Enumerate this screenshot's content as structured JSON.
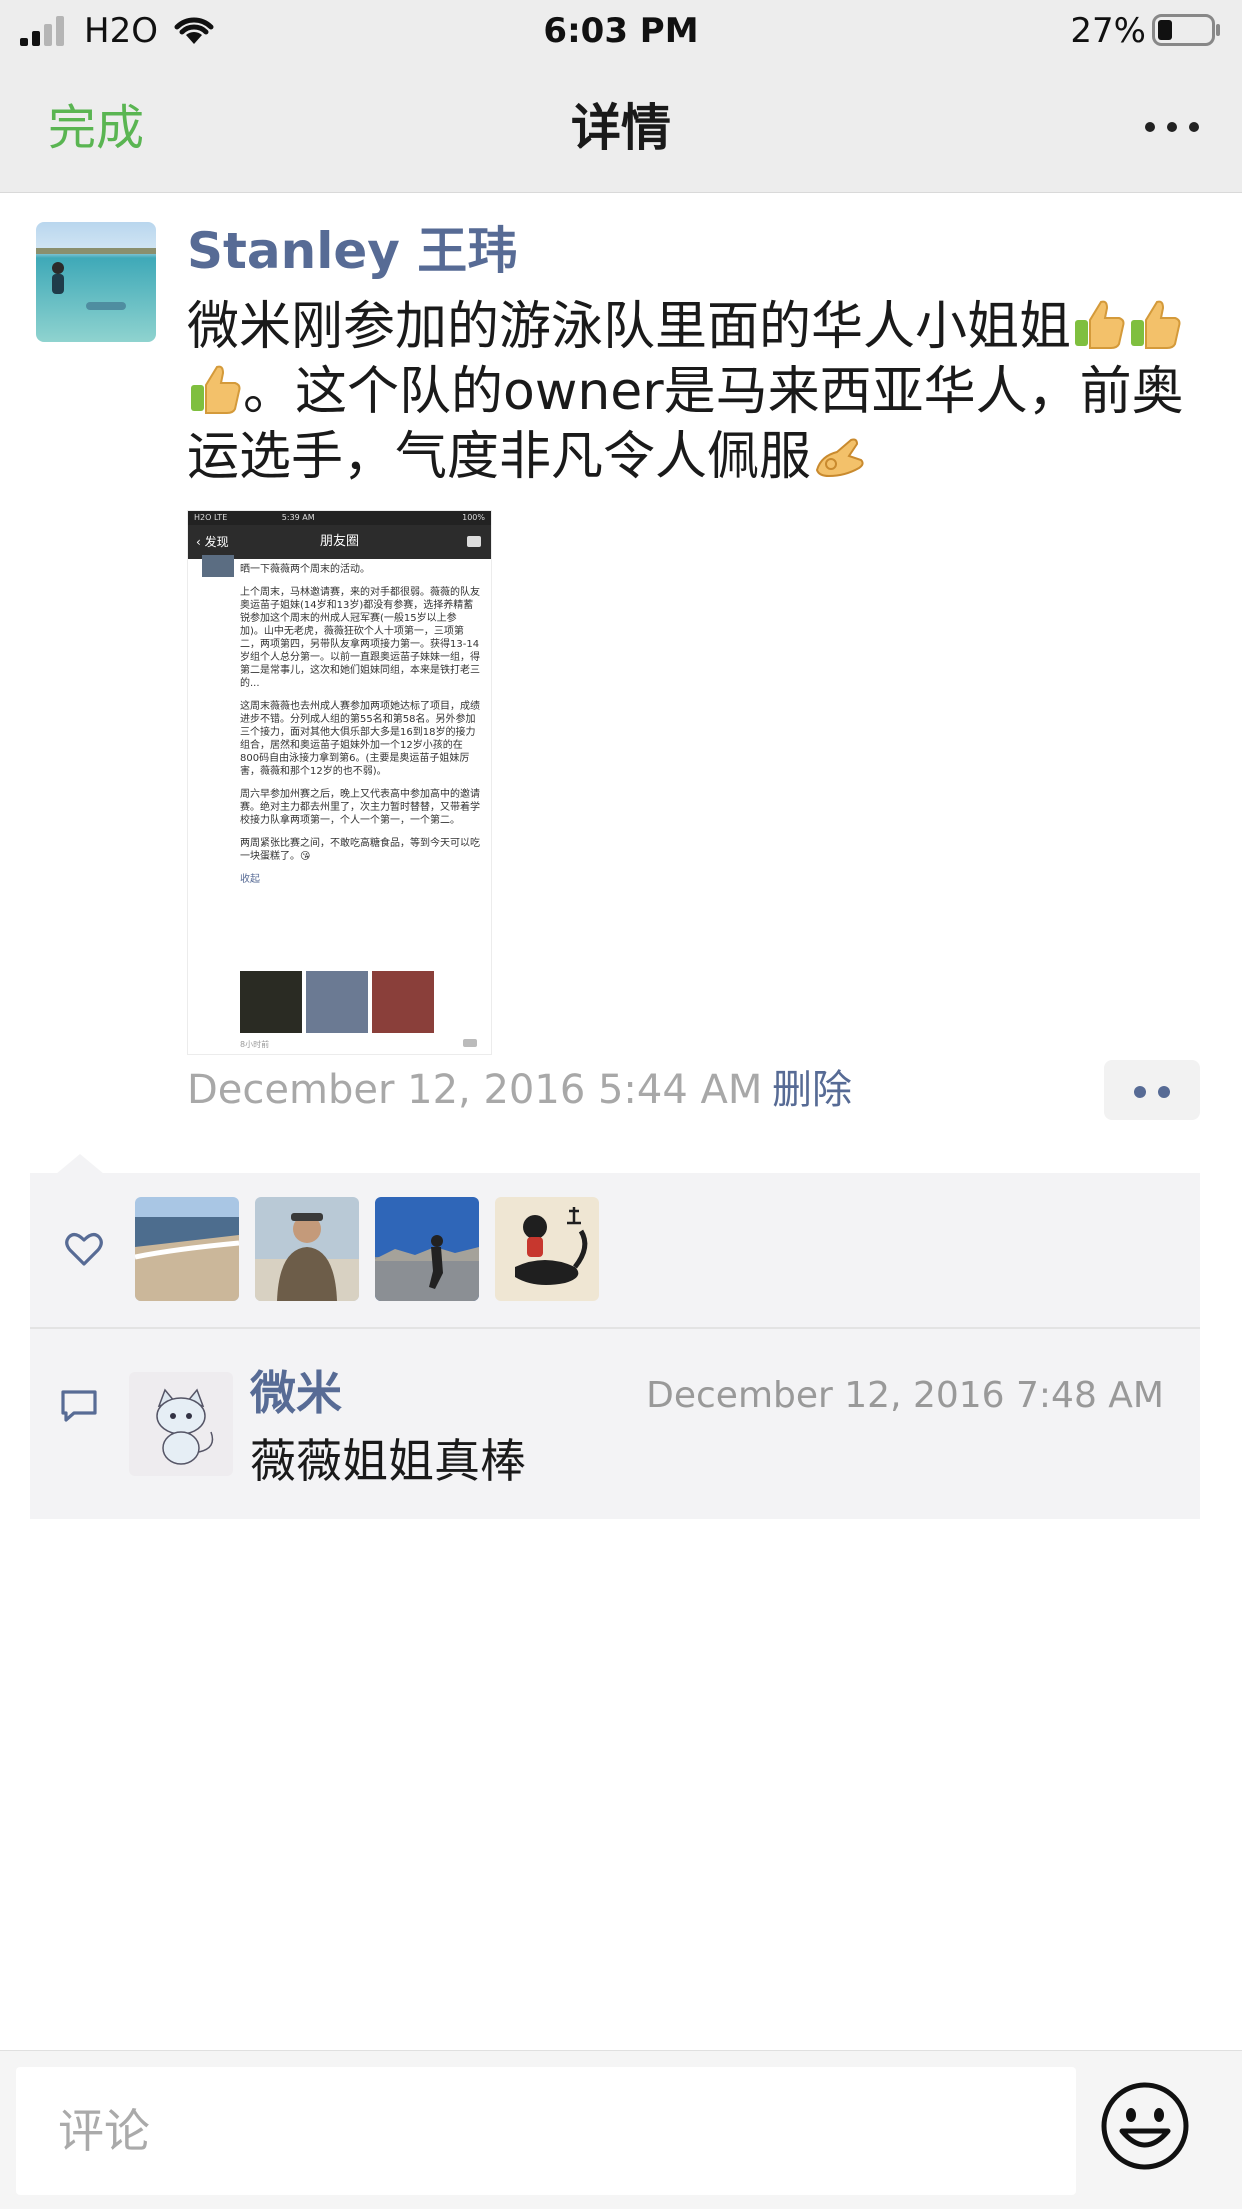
{
  "status_bar": {
    "carrier": "H2O",
    "time": "6:03 PM",
    "battery_percent": "27%",
    "battery_level": 0.27,
    "signal_bars": 2
  },
  "nav": {
    "done_label": "完成",
    "title": "详情",
    "more_icon": "more-icon"
  },
  "post": {
    "author": "Stanley 王玮",
    "text_parts": [
      "微米刚参加的游泳队里面的华人小姐姐",
      "。这个队的owner是马来西亚华人，前奥运选手，气度非凡令人佩服"
    ],
    "emojis": [
      "thumbs-up-icon",
      "thumbs-up-icon",
      "thumbs-up-icon",
      "ok-hand-icon"
    ],
    "time": "December 12, 2016 5:44 AM",
    "delete_label": "删除",
    "screenshot": {
      "status_left": "H2O LTE",
      "status_time": "5:39 AM",
      "status_right": "100%",
      "back_label": "发现",
      "title": "朋友圈",
      "paragraphs": [
        "晒一下薇薇两个周末的活动。",
        "上个周末，马林邀请赛，来的对手都很弱。薇薇的队友奥运苗子姐妹(14岁和13岁)都没有参赛，选择养精蓄锐参加这个周末的州成人冠军赛(一般15岁以上参加)。山中无老虎，薇薇狂砍个人十项第一，三项第二，两项第四，另带队友拿两项接力第一。获得13-14岁组个人总分第一。以前一直跟奥运苗子妹妹一组，得第二是常事儿，这次和她们姐妹同组，本来是铁打老三的...",
        "这周末薇薇也去州成人赛参加两项她达标了项目，成绩进步不错。分列成人组的第55名和第58名。另外参加三个接力，面对其他大俱乐部大多是16到18岁的接力组合，居然和奥运苗子姐妹外加一个12岁小孩的在800码自由泳接力拿到第6。(主要是奥运苗子姐妹厉害，薇薇和那个12岁的也不弱)。",
        "周六早参加州赛之后，晚上又代表高中参加高中的邀请赛。绝对主力都去州里了，次主力暂时替替，又带着学校接力队拿两项第一，个人一个第一，一个第二。",
        "两周紧张比赛之间，不敢吃高糖食品，等到今天可以吃一块蛋糕了。😘"
      ],
      "collapse_label": "收起",
      "time_label": "8小时前"
    }
  },
  "likes": {
    "icon": "heart-icon",
    "avatars": [
      "beach-avatar",
      "man-avatar",
      "runner-avatar",
      "scorpion-art-avatar"
    ]
  },
  "comments": [
    {
      "icon": "comment-icon",
      "avatar": "cat-avatar",
      "name": "微米",
      "time": "December 12, 2016 7:48 AM",
      "text": "薇薇姐姐真棒"
    }
  ],
  "input": {
    "placeholder": "评论",
    "emoji_icon": "smiley-face-icon"
  },
  "colors": {
    "link_blue": "#576b95",
    "done_green": "#5ab552",
    "bar_gray": "#ededed",
    "panel_gray": "#f3f3f5"
  }
}
